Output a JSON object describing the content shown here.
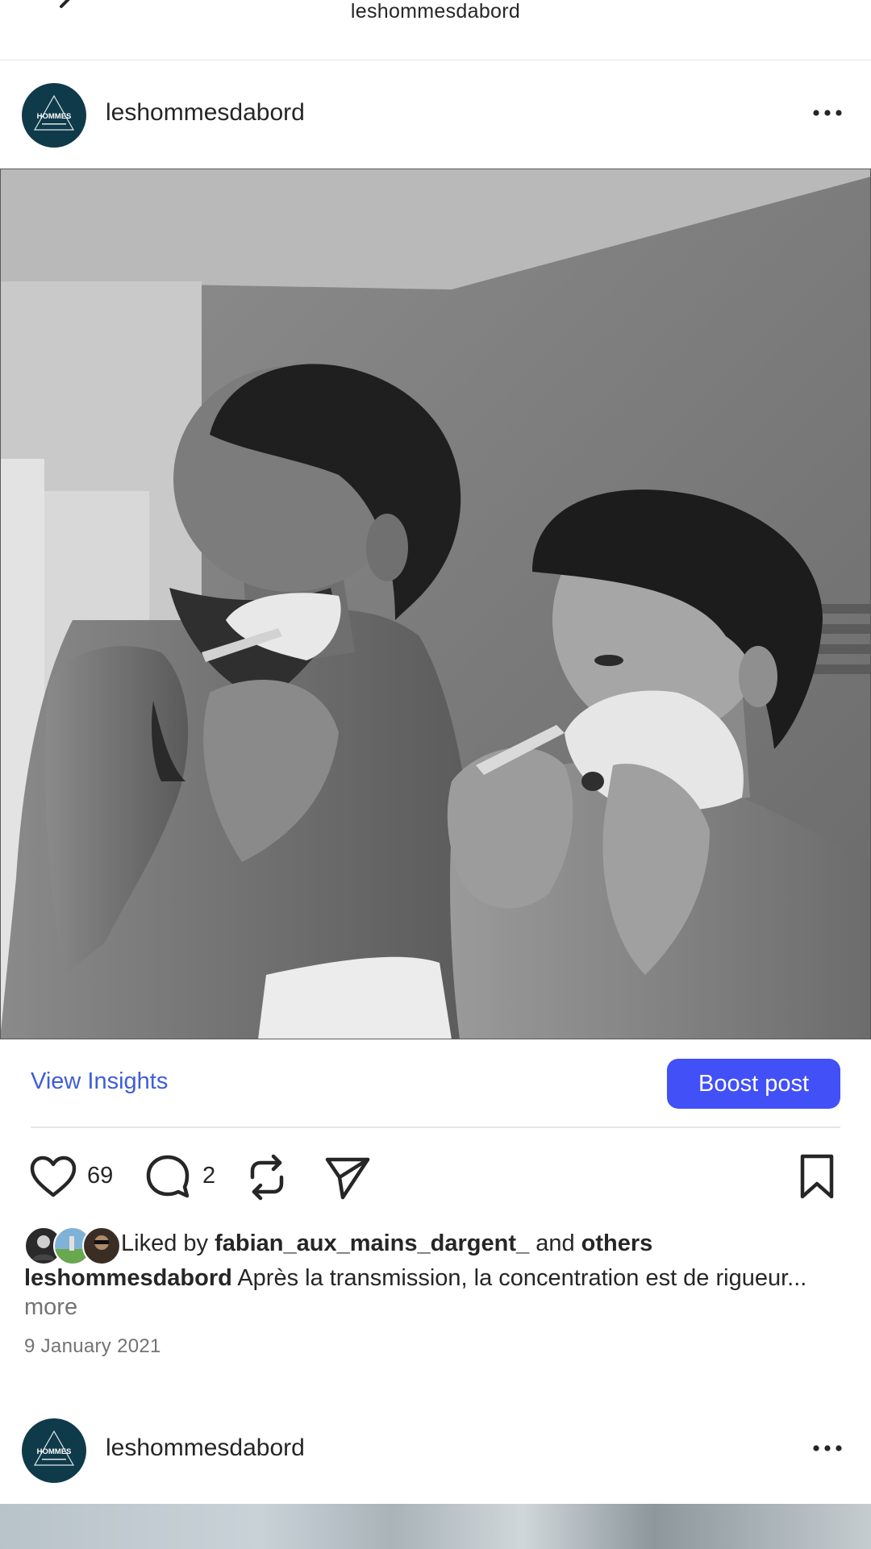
{
  "top_nav": {
    "title": "leshommesdabord"
  },
  "post": {
    "username": "leshommesdabord",
    "avatar_text": "HOMMES",
    "view_insights_label": "View Insights",
    "boost_label": "Boost post",
    "likes_count": "69",
    "comments_count": "2",
    "liked_by_prefix": "Liked by",
    "liked_by_user": "fabian_aux_mains_dargent_",
    "liked_by_and": "and",
    "liked_by_others": "others",
    "caption_user": "leshommesdabord",
    "caption_text": "Après la transmission, la concentration est de rigueur...",
    "more_label": "more",
    "date": "9 January 2021"
  },
  "next_post": {
    "username": "leshommesdabord",
    "avatar_text": "HOMMES"
  },
  "icons": {
    "back": "chevron-left-icon",
    "more": "more-horizontal-icon",
    "like": "heart-icon",
    "comment": "comment-icon",
    "repost": "repost-icon",
    "share": "send-icon",
    "save": "bookmark-icon"
  },
  "colors": {
    "link_blue": "#3f5ed8",
    "boost_blue": "#4150f7",
    "avatar_bg": "#0f3a4a",
    "muted_text": "#737373"
  }
}
